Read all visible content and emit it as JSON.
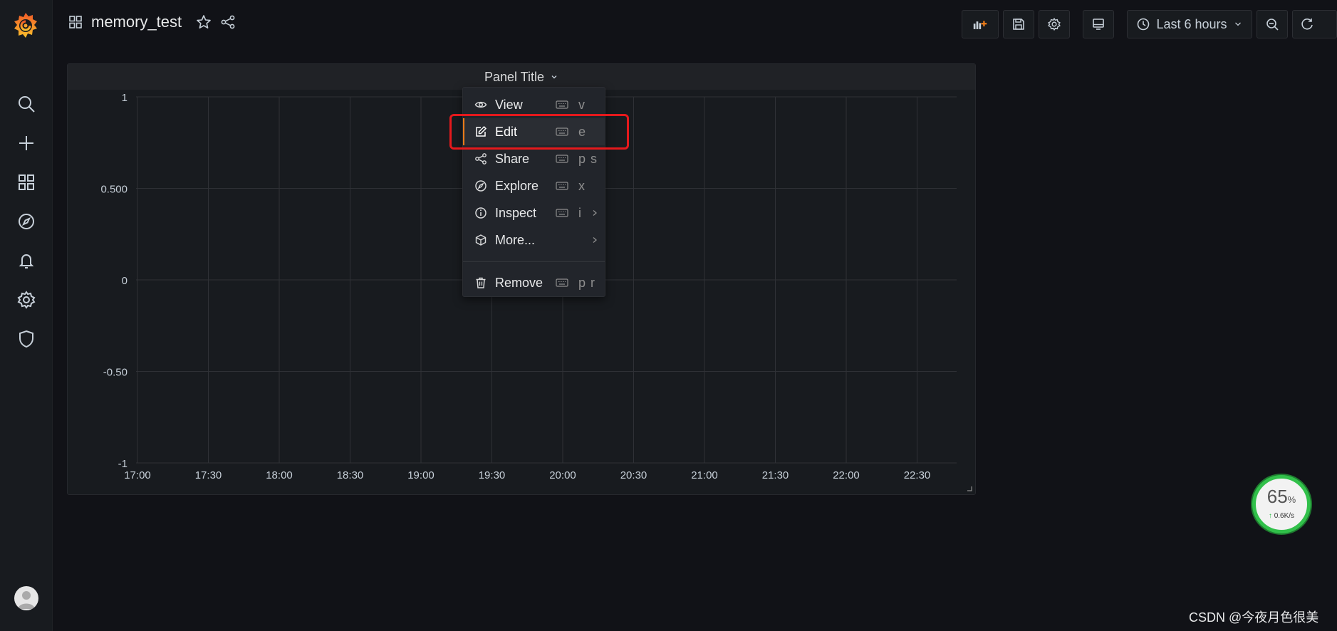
{
  "dashboard": {
    "title": "memory_test"
  },
  "toolbar": {
    "time_range": "Last 6 hours"
  },
  "panel": {
    "title": "Panel Title"
  },
  "chart_data": {
    "type": "line",
    "title": "Panel Title",
    "x_ticks": [
      "17:00",
      "17:30",
      "18:00",
      "18:30",
      "19:00",
      "19:30",
      "20:00",
      "20:30",
      "21:00",
      "21:30",
      "22:00",
      "22:30"
    ],
    "y_ticks": [
      "1",
      "0.500",
      "0",
      "-0.50",
      "-1"
    ],
    "ylim": [
      -1,
      1
    ],
    "series": [],
    "grid": true
  },
  "menu": {
    "items": [
      {
        "label": "View",
        "shortcut": "v",
        "icon": "eye-icon"
      },
      {
        "label": "Edit",
        "shortcut": "e",
        "icon": "edit-icon"
      },
      {
        "label": "Share",
        "shortcut": "p s",
        "icon": "share-icon"
      },
      {
        "label": "Explore",
        "shortcut": "x",
        "icon": "compass-icon"
      },
      {
        "label": "Inspect",
        "shortcut": "i",
        "icon": "info-icon"
      },
      {
        "label": "More...",
        "shortcut": "",
        "icon": "cube-icon"
      },
      {
        "label": "Remove",
        "shortcut": "p r",
        "icon": "trash-icon"
      }
    ]
  },
  "speed_widget": {
    "percent": "65",
    "percent_unit": "%",
    "rate": "0.6K/s"
  },
  "watermark": "CSDN @今夜月色很美",
  "colors": {
    "accent": "#eb7b18",
    "highlight": "#e5191c",
    "background": "#111217",
    "panel": "#181b1f"
  }
}
